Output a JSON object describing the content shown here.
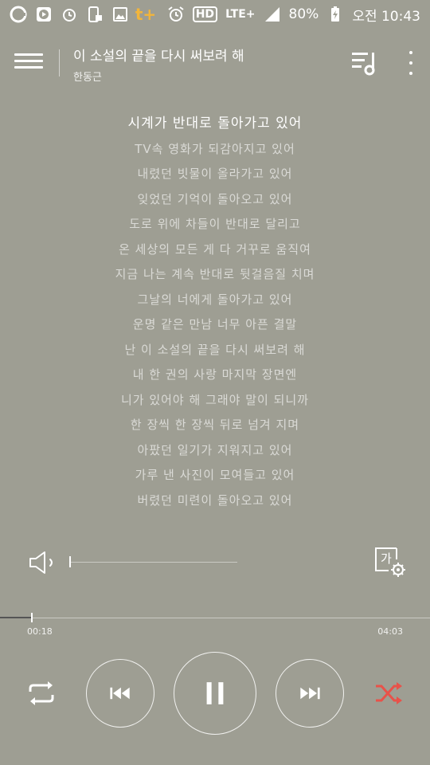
{
  "status_bar": {
    "left_icons": [
      "olleh-logo-icon",
      "video-player-icon",
      "alarm-icon",
      "phone-transfer-icon",
      "gallery-icon",
      "tplus-icon"
    ],
    "tplus_label": "t+",
    "hd_label": "HD",
    "network_label": "LTE+",
    "battery_percent": "80%",
    "time": "오전 10:43"
  },
  "header": {
    "title": "이 소설의 끝을 다시 써보려 해",
    "artist": "한동근"
  },
  "lyrics": {
    "lines": [
      "시계가 반대로 돌아가고 있어",
      "TV속 영화가 되감아지고 있어",
      "내렸던 빗물이 올라가고 있어",
      "잊었던 기억이 돌아오고 있어",
      "도로 위에 차들이 반대로 달리고",
      "온 세상의 모든 게 다 거꾸로 움직여",
      "지금 나는 계속 반대로 뒷걸음질 치며",
      "그날의 너에게 돌아가고 있어",
      "운명 같은 만남 너무 아픈 결말",
      "난 이 소설의 끝을 다시 써보려 해",
      "내 한 권의 사랑 마지막 장면엔",
      "니가 있어야 해 그래야 말이 되니까",
      "한 장씩 한 장씩 뒤로 넘겨 지며",
      "아팠던 일기가 지워지고 있어",
      "가루 낸 사진이 모여들고 있어",
      "버렸던 미련이 돌아오고 있어"
    ],
    "current_index": 0
  },
  "volume": {
    "level": 0.0
  },
  "font_setting": {
    "label": "가"
  },
  "progress": {
    "elapsed": "00:18",
    "total": "04:03",
    "fraction": 0.074
  },
  "colors": {
    "background": "#9e9e93",
    "shuffle_active": "#e8524a",
    "tplus": "#f2b53b"
  }
}
